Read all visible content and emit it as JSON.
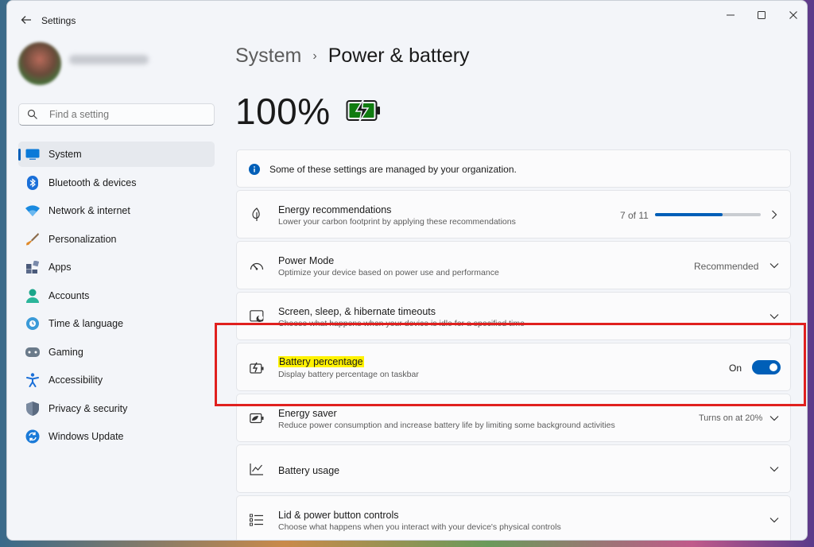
{
  "window": {
    "title": "Settings"
  },
  "search": {
    "placeholder": "Find a setting"
  },
  "sidebar": {
    "items": [
      {
        "label": "System",
        "icon": "system-icon",
        "active": true
      },
      {
        "label": "Bluetooth & devices",
        "icon": "bluetooth-icon"
      },
      {
        "label": "Network & internet",
        "icon": "wifi-icon"
      },
      {
        "label": "Personalization",
        "icon": "brush-icon"
      },
      {
        "label": "Apps",
        "icon": "apps-icon"
      },
      {
        "label": "Accounts",
        "icon": "accounts-icon"
      },
      {
        "label": "Time & language",
        "icon": "globe-icon"
      },
      {
        "label": "Gaming",
        "icon": "gamepad-icon"
      },
      {
        "label": "Accessibility",
        "icon": "accessibility-icon"
      },
      {
        "label": "Privacy & security",
        "icon": "shield-icon"
      },
      {
        "label": "Windows Update",
        "icon": "update-icon"
      }
    ]
  },
  "header": {
    "parent": "System",
    "separator": "›",
    "title": "Power & battery"
  },
  "battery": {
    "percent_label": "100%",
    "level": 1.0,
    "charging": true
  },
  "org_notice": "Some of these settings are managed by your organization.",
  "cards": {
    "energy": {
      "title": "Energy recommendations",
      "desc": "Lower your carbon footprint by applying these recommendations",
      "count": "7 of 11",
      "progress": 0.636
    },
    "power_mode": {
      "title": "Power Mode",
      "desc": "Optimize your device based on power use and performance",
      "value": "Recommended"
    },
    "screen_sleep": {
      "title": "Screen, sleep, & hibernate timeouts",
      "desc": "Choose what happens when your device is idle for a specified time"
    },
    "battery_pct": {
      "title": "Battery percentage",
      "desc": "Display battery percentage on taskbar",
      "state": "On"
    },
    "energy_saver": {
      "title": "Energy saver",
      "desc": "Reduce power consumption and increase battery life by limiting some background activities",
      "value": "Turns on at 20%"
    },
    "battery_usage": {
      "title": "Battery usage"
    },
    "lid": {
      "title": "Lid & power button controls",
      "desc": "Choose what happens when you interact with your device's physical controls"
    }
  },
  "colors": {
    "accent": "#005fb8",
    "battery_green": "#107c10",
    "annotation_red": "#e0201e",
    "highlight_yellow": "#fff200"
  }
}
